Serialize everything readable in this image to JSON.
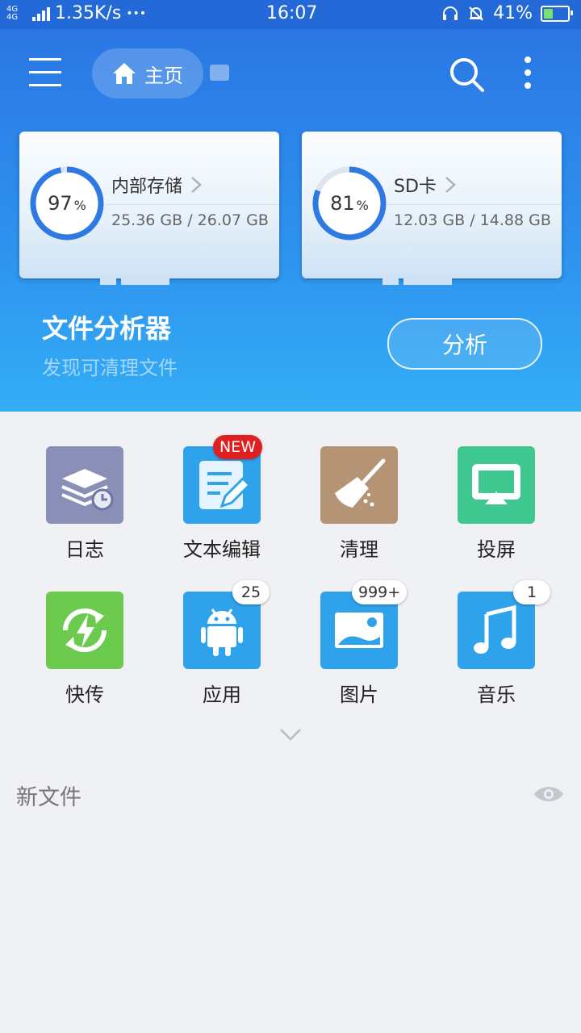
{
  "status_bar": {
    "network": "4G 4G",
    "speed": "1.35K/s",
    "dots": "•••",
    "time": "16:07",
    "battery": "41%",
    "battery_level": 0.41
  },
  "toolbar": {
    "home_label": "主页",
    "menu_icon": "hamburger-menu-icon",
    "search_icon": "search-icon",
    "more_icon": "more-vertical-icon"
  },
  "storage": [
    {
      "percent": "97",
      "percent_sign": "%",
      "percent_value": 97,
      "title": "内部存储",
      "usage": "25.36 GB / 26.07 GB"
    },
    {
      "percent": "81",
      "percent_sign": "%",
      "percent_value": 81,
      "title": "SD卡",
      "usage": "12.03 GB / 14.88 GB"
    }
  ],
  "analyzer": {
    "title": "文件分析器",
    "subtitle": "发现可清理文件",
    "button": "分析"
  },
  "tools": [
    {
      "label": "日志",
      "icon": "log-stack-clock-icon",
      "color": "#8a8fb8",
      "badge": ""
    },
    {
      "label": "文本编辑",
      "icon": "text-edit-icon",
      "color": "#2ea2ea",
      "badge": "NEW"
    },
    {
      "label": "清理",
      "icon": "broom-icon",
      "color": "#b59476",
      "badge": ""
    },
    {
      "label": "投屏",
      "icon": "cast-screen-icon",
      "color": "#3ec78e",
      "badge": ""
    },
    {
      "label": "快传",
      "icon": "quick-transfer-icon",
      "color": "#6ccb4e",
      "badge": ""
    },
    {
      "label": "应用",
      "icon": "android-icon",
      "color": "#2ea2ea",
      "badge": "25"
    },
    {
      "label": "图片",
      "icon": "picture-icon",
      "color": "#2ea2ea",
      "badge": "999+"
    },
    {
      "label": "音乐",
      "icon": "music-note-icon",
      "color": "#2ea2ea",
      "badge": "1"
    }
  ],
  "new_files": {
    "title": "新文件",
    "icon": "eye-icon"
  }
}
